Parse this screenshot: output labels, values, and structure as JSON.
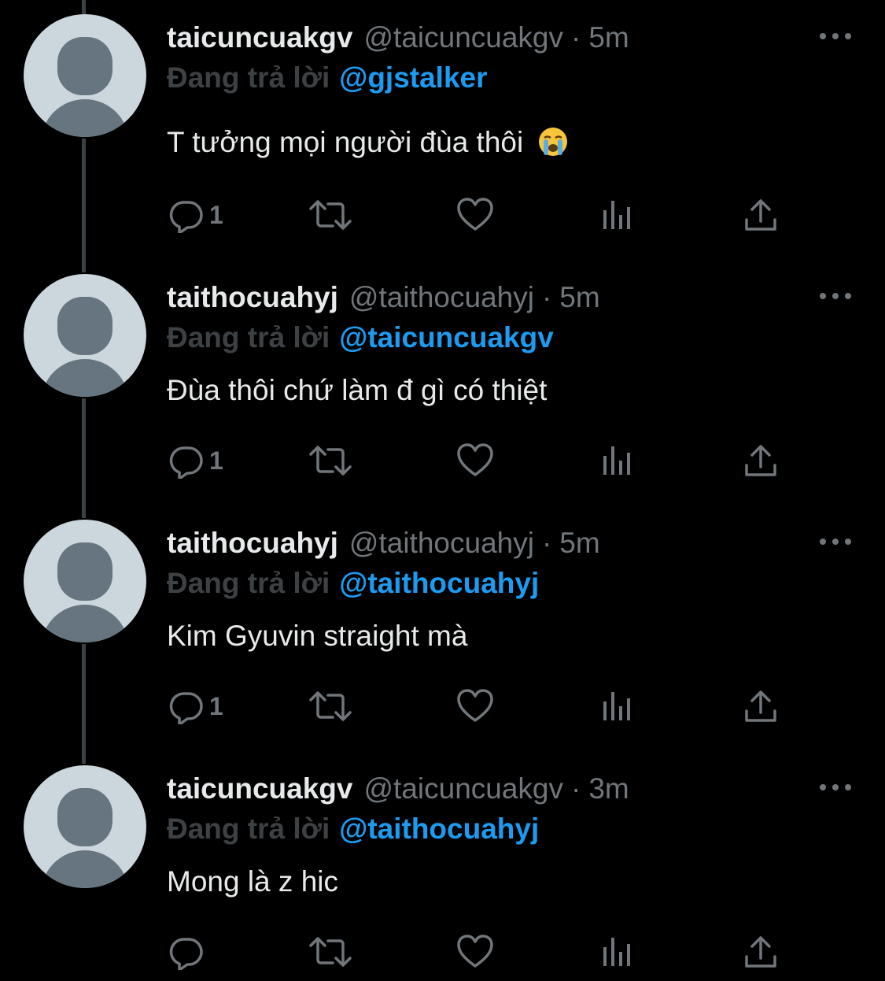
{
  "tweets": [
    {
      "name": "taicuncuakgv",
      "handle": "@taicuncuakgv",
      "separator": "·",
      "time": "5m",
      "replying_label": "Đang trả lời",
      "replying_to": "@gjstalker",
      "text": "T tưởng mọi người đùa thôi",
      "emoji": "loudly-crying-face",
      "reply_count": "1"
    },
    {
      "name": "taithocuahyj",
      "handle": "@taithocuahyj",
      "separator": "·",
      "time": "5m",
      "replying_label": "Đang trả lời",
      "replying_to": "@taicuncuakgv",
      "text": "Đùa thôi chứ làm đ gì có thiệt",
      "reply_count": "1"
    },
    {
      "name": "taithocuahyj",
      "handle": "@taithocuahyj",
      "separator": "·",
      "time": "5m",
      "replying_label": "Đang trả lời",
      "replying_to": "@taithocuahyj",
      "text": "Kim Gyuvin straight mà",
      "reply_count": "1"
    },
    {
      "name": "taicuncuakgv",
      "handle": "@taicuncuakgv",
      "separator": "·",
      "time": "3m",
      "replying_label": "Đang trả lời",
      "replying_to": "@taithocuahyj",
      "text": "Mong là z hic",
      "reply_count": ""
    }
  ],
  "colors": {
    "background": "#000000",
    "primary_text": "#e7e9ea",
    "secondary_text": "#71767b",
    "mention": "#1d9bf0",
    "thread_line": "#3e4144",
    "avatar_bg": "#ccd6dd",
    "avatar_fg": "#66757f"
  },
  "icons": [
    "more-icon",
    "reply-icon",
    "retweet-icon",
    "like-icon",
    "views-icon",
    "share-icon"
  ]
}
